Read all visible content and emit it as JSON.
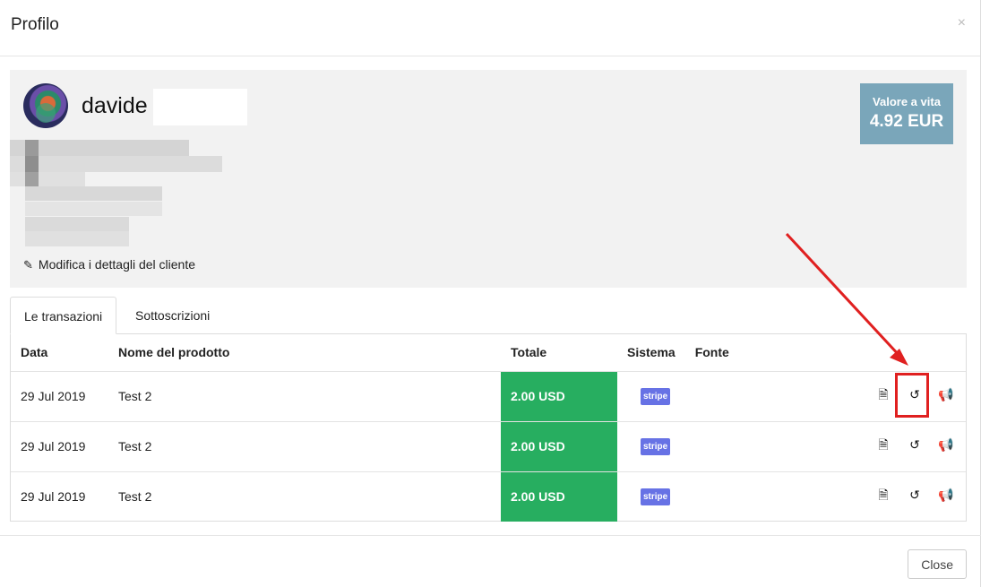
{
  "modal": {
    "title": "Profilo",
    "close_glyph": "×",
    "close_button": "Close"
  },
  "profile": {
    "name": "davide",
    "edit_link": "Modifica i dettagli del cliente",
    "lifetime_label": "Valore a vita",
    "lifetime_value": "4.92 EUR"
  },
  "tabs": [
    {
      "label": "Le transazioni",
      "active": true
    },
    {
      "label": "Sottoscrizioni",
      "active": false
    }
  ],
  "table": {
    "headers": [
      "Data",
      "Nome del prodotto",
      "Totale",
      "Sistema",
      "Fonte"
    ],
    "rows": [
      {
        "date": "29 Jul 2019",
        "product": "Test 2",
        "total": "2.00 USD",
        "system": "stripe",
        "source": ""
      },
      {
        "date": "29 Jul 2019",
        "product": "Test 2",
        "total": "2.00 USD",
        "system": "stripe",
        "source": ""
      },
      {
        "date": "29 Jul 2019",
        "product": "Test 2",
        "total": "2.00 USD",
        "system": "stripe",
        "source": ""
      }
    ]
  },
  "icons": {
    "invoice": "document-icon",
    "refund": "refund-icon",
    "announce": "megaphone-icon",
    "edit": "pencil-icon"
  },
  "colors": {
    "total_bg": "#27ae60",
    "lifetime_bg": "#7aa6ba",
    "stripe": "#6772e5",
    "annotation": "#e02020"
  }
}
